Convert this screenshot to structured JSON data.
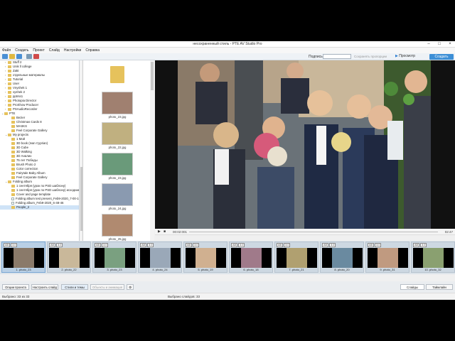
{
  "window": {
    "title": "несохраненный стиль - PTE AV Studio Pro"
  },
  "menu": [
    "Файл",
    "Создать",
    "Проект",
    "Слайд",
    "Настройки",
    "Справка"
  ],
  "toolbar": {
    "caption_label": "Подпись",
    "keep_ratio_label": "Сохранять пропорции",
    "preview_label": "Просмотр",
    "create_label": "Создать"
  },
  "tree": [
    {
      "label": "Stuff 2",
      "indent": 1,
      "type": "folder",
      "arrow": "›"
    },
    {
      "label": "Unik ll college",
      "indent": 1,
      "type": "folder",
      "arrow": "›"
    },
    {
      "label": "Zakt",
      "indent": 1,
      "type": "folder",
      "arrow": "›"
    },
    {
      "label": "отдельные материалы",
      "indent": 1,
      "type": "folder",
      "arrow": "›"
    },
    {
      "label": "Tutorial",
      "indent": 1,
      "type": "folder",
      "arrow": "›"
    },
    {
      "label": "User",
      "indent": 1,
      "type": "folder",
      "arrow": "›"
    },
    {
      "label": "Vnyshek 1",
      "indent": 1,
      "type": "folder",
      "arrow": "›"
    },
    {
      "label": "vyshek 2",
      "indent": 1,
      "type": "folder",
      "arrow": "›"
    },
    {
      "label": "pptrss1",
      "indent": 1,
      "type": "folder",
      "arrow": "›"
    },
    {
      "label": "Photopia Director",
      "indent": 1,
      "type": "folder",
      "arrow": "›"
    },
    {
      "label": "ProShow Producer",
      "indent": 1,
      "type": "folder",
      "arrow": "›"
    },
    {
      "label": "PSAudioRecorder",
      "indent": 1,
      "type": "folder",
      "arrow": "›"
    },
    {
      "label": "PTE",
      "indent": 0,
      "type": "folder",
      "arrow": "⌄"
    },
    {
      "label": "Bezier",
      "indent": 2,
      "type": "folder",
      "arrow": ""
    },
    {
      "label": "Christmas Cards 8",
      "indent": 2,
      "type": "folder",
      "arrow": ""
    },
    {
      "label": "MASKS",
      "indent": 2,
      "type": "folder",
      "arrow": ""
    },
    {
      "label": "Feel Corporate Gallery",
      "indent": 2,
      "type": "folder",
      "arrow": ""
    },
    {
      "label": "My projects",
      "indent": 1,
      "type": "folder",
      "arrow": "⌄"
    },
    {
      "label": "1 Мой",
      "indent": 2,
      "type": "folder",
      "arrow": ""
    },
    {
      "label": "3D book (Ivan Cyprian)",
      "indent": 2,
      "type": "folder",
      "arrow": ""
    },
    {
      "label": "3D Cube",
      "indent": 2,
      "type": "folder",
      "arrow": ""
    },
    {
      "label": "3D Walking",
      "indent": 2,
      "type": "folder",
      "arrow": ""
    },
    {
      "label": "3D Анализ",
      "indent": 2,
      "type": "folder",
      "arrow": ""
    },
    {
      "label": "75 лет Победы",
      "indent": 2,
      "type": "folder",
      "arrow": ""
    },
    {
      "label": "Brush Photo 2",
      "indent": 2,
      "type": "folder",
      "arrow": ""
    },
    {
      "label": "Color correction",
      "indent": 2,
      "type": "folder",
      "arrow": ""
    },
    {
      "label": "Fairytale Baby Album",
      "indent": 2,
      "type": "folder",
      "arrow": ""
    },
    {
      "label": "Feel Corporate Gallery",
      "indent": 2,
      "type": "folder",
      "arrow": ""
    },
    {
      "label": "Folding album",
      "indent": 1,
      "type": "folder",
      "arrow": "⌄"
    },
    {
      "label": "1 сентября (урок по PSD шаблону)",
      "indent": 2,
      "type": "folder",
      "arrow": ""
    },
    {
      "label": "1 сентября (урок по PSD шаблону) исходник",
      "indent": 2,
      "type": "folder",
      "arrow": ""
    },
    {
      "label": "Cover and page template",
      "indent": 2,
      "type": "folder",
      "arrow": ""
    },
    {
      "label": "Folding album test present_Feb9-2020_7-00-15",
      "indent": 2,
      "type": "file",
      "arrow": ""
    },
    {
      "label": "Folding album_Feb9-2020_6-48-46",
      "indent": 2,
      "type": "file",
      "arrow": ""
    },
    {
      "label": "People_2",
      "indent": 2,
      "type": "folder",
      "arrow": "",
      "selected": true
    }
  ],
  "files": [
    "photo_23.jpg",
    "photo_22.jpg",
    "photo_23.jpg",
    "photo_24.jpg",
    "photo_25.jpg"
  ],
  "timeline": {
    "current": "00:02:001",
    "end": "02:47"
  },
  "slides": [
    {
      "label": "1. photo_23",
      "dur": "3.0"
    },
    {
      "label": "2. photo_22",
      "dur": "3.0"
    },
    {
      "label": "3. photo_23",
      "dur": "3.0"
    },
    {
      "label": "4. photo_24",
      "dur": "3.0"
    },
    {
      "label": "5. photo_19",
      "dur": "3.0"
    },
    {
      "label": "6. photo_18",
      "dur": "3.0"
    },
    {
      "label": "7. photo_21",
      "dur": "3.0"
    },
    {
      "label": "8. photo_20",
      "dur": "3.0"
    },
    {
      "label": "9. photo_31",
      "dur": "3.0"
    },
    {
      "label": "10. photo_32",
      "dur": "3.0"
    }
  ],
  "bottom": {
    "project_options": "Опции проекта",
    "slide_settings": "Настроить слайд",
    "styles_themes": "Стили и темы",
    "objects_animation": "Объекты и анимация",
    "tab_slides": "Слайды",
    "tab_timeline": "Таймлайн"
  },
  "status": {
    "selected_files": "Выбрано: 33 из 33",
    "selected_slides": "Выбрано слайдов: 33"
  }
}
